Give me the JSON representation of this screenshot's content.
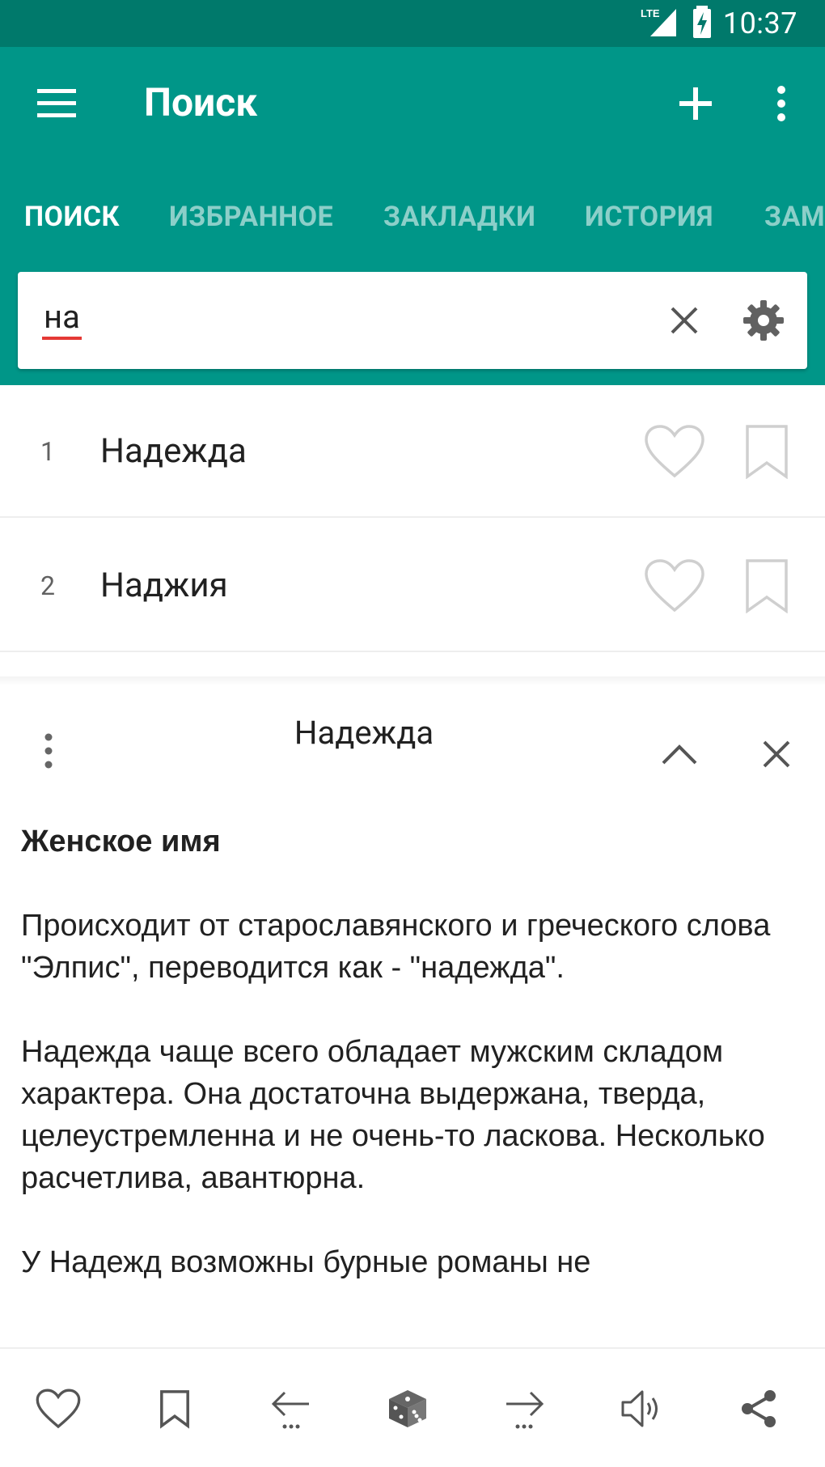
{
  "status_bar": {
    "network": "LTE",
    "time": "10:37"
  },
  "app_bar": {
    "title": "Поиск",
    "icons": {
      "menu": "menu-icon",
      "add": "plus-icon",
      "more": "more-vert-icon"
    }
  },
  "tabs": [
    {
      "label": "ПОИСК",
      "active": true
    },
    {
      "label": "ИЗБРАННОЕ",
      "active": false
    },
    {
      "label": "ЗАКЛАДКИ",
      "active": false
    },
    {
      "label": "ИСТОРИЯ",
      "active": false
    },
    {
      "label": "ЗАМ",
      "active": false
    }
  ],
  "search": {
    "value": "на",
    "placeholder": ""
  },
  "results": [
    {
      "number": "1",
      "word": "Надежда"
    },
    {
      "number": "2",
      "word": "Наджия"
    }
  ],
  "detail": {
    "title": "Надежда",
    "heading": "Женское имя",
    "paragraphs": [
      "Происходит от старославянского и греческого слова \"Элпис\", переводится как - \"надежда\".",
      "Надежда чаще всего обладает мужским складом характера. Она достаточна выдержана, тверда, целеустремленна и не очень-то ласкова. Несколько расчетлива, авантюрна.",
      "У Надежд возможны бурные романы не"
    ]
  },
  "bottom_bar": {
    "icons": [
      "heart-outline-icon",
      "bookmark-outline-icon",
      "arrow-left-icon",
      "dice-icon",
      "arrow-right-icon",
      "speaker-icon",
      "share-icon"
    ]
  },
  "colors": {
    "primary": "#009688",
    "primary_dark": "#00796B",
    "accent_underline": "#e53935"
  }
}
